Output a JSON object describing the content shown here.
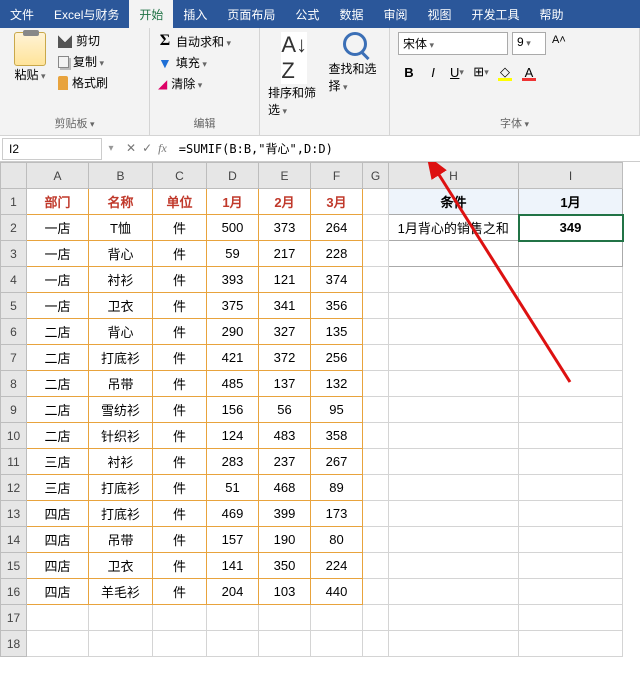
{
  "menu": {
    "tabs": [
      "文件",
      "Excel与财务",
      "开始",
      "插入",
      "页面布局",
      "公式",
      "数据",
      "审阅",
      "视图",
      "开发工具",
      "帮助"
    ],
    "active_index": 2
  },
  "ribbon": {
    "clipboard": {
      "paste": "粘贴",
      "cut": "剪切",
      "copy": "复制",
      "brush": "格式刷",
      "group": "剪贴板"
    },
    "edit": {
      "autosum": "自动求和",
      "fill": "填充",
      "clear": "清除",
      "group": "编辑"
    },
    "sortfind": {
      "sort": "排序和筛选",
      "find": "查找和选择"
    },
    "font": {
      "name": "宋体",
      "size": "9",
      "group": "字体"
    }
  },
  "formula_bar": {
    "cell_ref": "I2",
    "formula": "=SUMIF(B:B,\"背心\",D:D)"
  },
  "columns": [
    "A",
    "B",
    "C",
    "D",
    "E",
    "F",
    "G",
    "H",
    "I"
  ],
  "headers": {
    "A": "部门",
    "B": "名称",
    "C": "单位",
    "D": "1月",
    "E": "2月",
    "F": "3月",
    "H": "条件",
    "I": "1月"
  },
  "side": {
    "label": "1月背心的销售之和",
    "value": "349"
  },
  "rows": [
    {
      "A": "一店",
      "B": "T恤",
      "C": "件",
      "D": "500",
      "E": "373",
      "F": "264"
    },
    {
      "A": "一店",
      "B": "背心",
      "C": "件",
      "D": "59",
      "E": "217",
      "F": "228"
    },
    {
      "A": "一店",
      "B": "衬衫",
      "C": "件",
      "D": "393",
      "E": "121",
      "F": "374"
    },
    {
      "A": "一店",
      "B": "卫衣",
      "C": "件",
      "D": "375",
      "E": "341",
      "F": "356"
    },
    {
      "A": "二店",
      "B": "背心",
      "C": "件",
      "D": "290",
      "E": "327",
      "F": "135"
    },
    {
      "A": "二店",
      "B": "打底衫",
      "C": "件",
      "D": "421",
      "E": "372",
      "F": "256"
    },
    {
      "A": "二店",
      "B": "吊带",
      "C": "件",
      "D": "485",
      "E": "137",
      "F": "132"
    },
    {
      "A": "二店",
      "B": "雪纺衫",
      "C": "件",
      "D": "156",
      "E": "56",
      "F": "95"
    },
    {
      "A": "二店",
      "B": "针织衫",
      "C": "件",
      "D": "124",
      "E": "483",
      "F": "358"
    },
    {
      "A": "三店",
      "B": "衬衫",
      "C": "件",
      "D": "283",
      "E": "237",
      "F": "267"
    },
    {
      "A": "三店",
      "B": "打底衫",
      "C": "件",
      "D": "51",
      "E": "468",
      "F": "89"
    },
    {
      "A": "四店",
      "B": "打底衫",
      "C": "件",
      "D": "469",
      "E": "399",
      "F": "173"
    },
    {
      "A": "四店",
      "B": "吊带",
      "C": "件",
      "D": "157",
      "E": "190",
      "F": "80"
    },
    {
      "A": "四店",
      "B": "卫衣",
      "C": "件",
      "D": "141",
      "E": "350",
      "F": "224"
    },
    {
      "A": "四店",
      "B": "羊毛衫",
      "C": "件",
      "D": "204",
      "E": "103",
      "F": "440"
    }
  ]
}
